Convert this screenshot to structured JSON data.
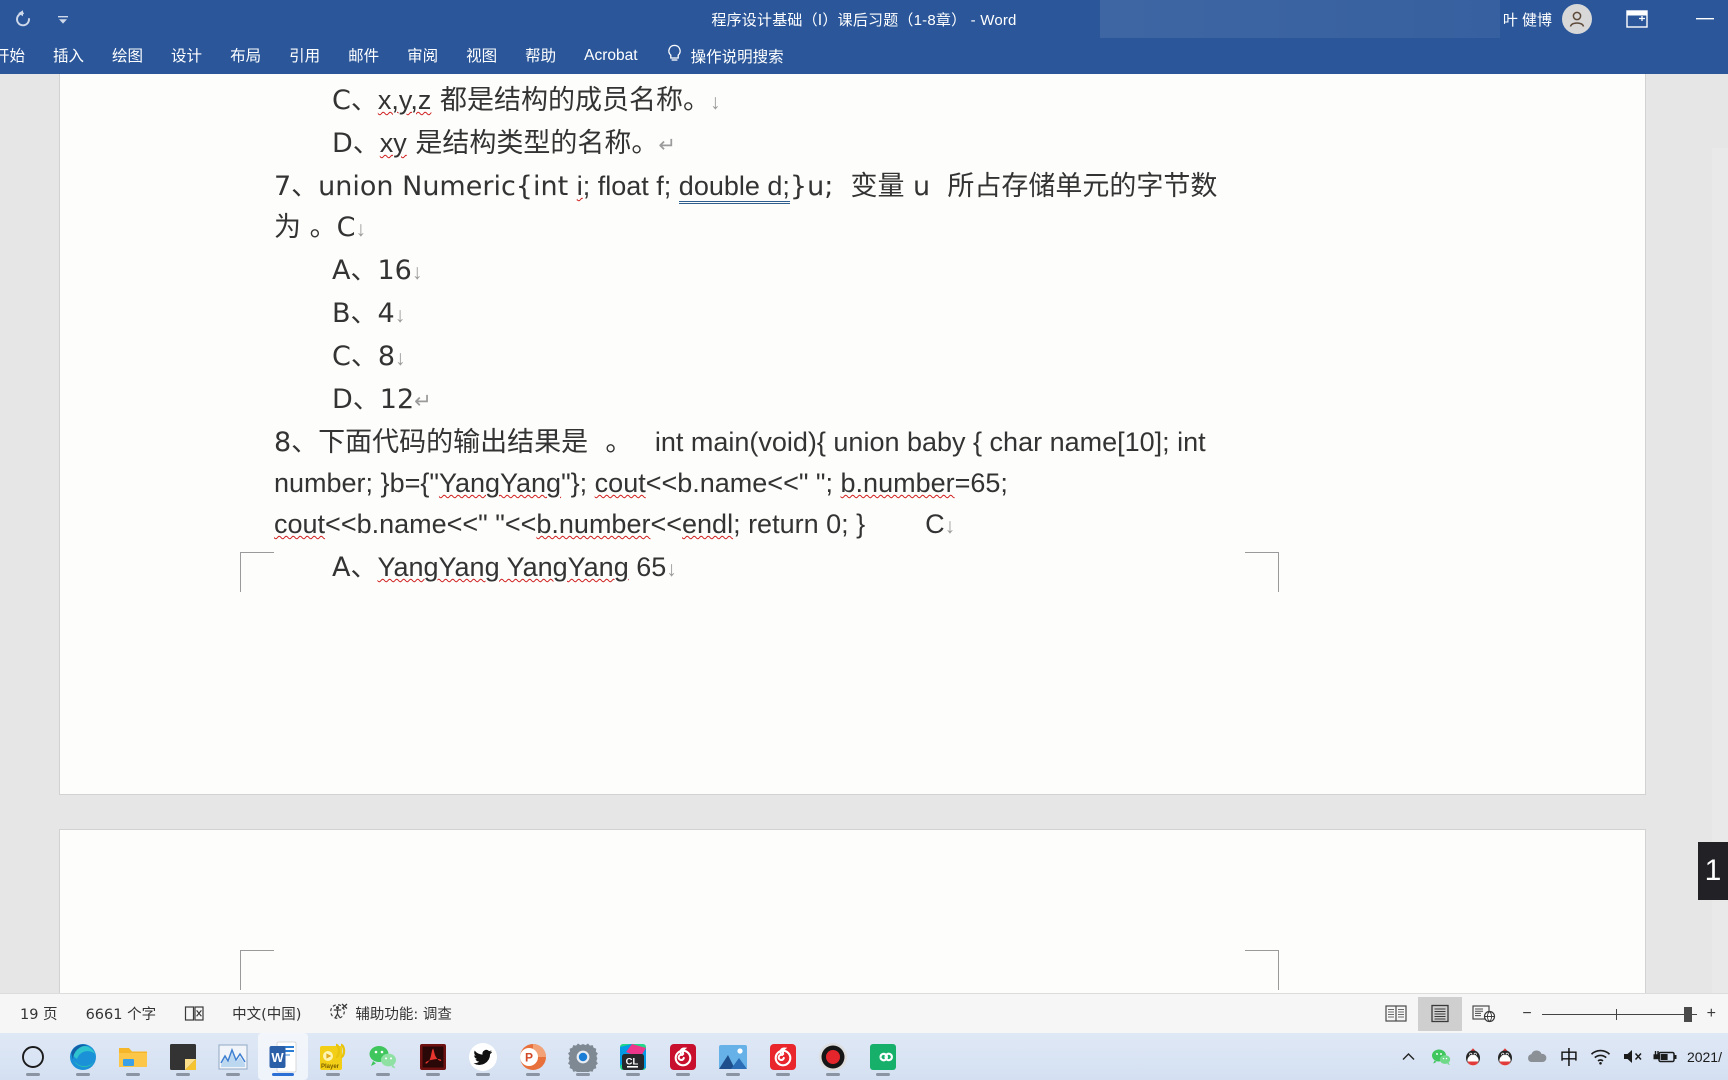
{
  "titlebar": {
    "quick_access": [
      {
        "name": "redo-icon",
        "label": "撤销/恢复"
      },
      {
        "name": "customize-quick-access-chevron-icon",
        "label": "自定义快速访问工具栏"
      }
    ],
    "document_title": "程序设计基础（Ⅰ）课后习题（1-8章）  -  Word",
    "user_name": "叶 健博",
    "avatar_name": "user-avatar",
    "ribbon_display_options_label": "功能区显示选项",
    "minimize_label": "最小化",
    "accent_color": "#2b579a"
  },
  "ribbon": {
    "tabs": [
      {
        "label": "开始"
      },
      {
        "label": "插入"
      },
      {
        "label": "绘图"
      },
      {
        "label": "设计"
      },
      {
        "label": "布局"
      },
      {
        "label": "引用"
      },
      {
        "label": "邮件"
      },
      {
        "label": "审阅"
      },
      {
        "label": "视图"
      },
      {
        "label": "帮助"
      },
      {
        "label": "Acrobat"
      }
    ],
    "tell_me": "操作说明搜索",
    "tell_me_icon": "lightbulb-icon"
  },
  "document": {
    "lines": [
      {
        "id": "opt-c-struct-members",
        "indent": "indent1",
        "segments": [
          {
            "text": "C、",
            "style": "cjk"
          },
          {
            "text": "x,y,z",
            "style": "spell"
          },
          {
            "text": " 都是结构的成员名称。",
            "style": "cjk"
          },
          {
            "text": "↓",
            "style": "mark"
          }
        ]
      },
      {
        "id": "opt-d-struct-type-name",
        "indent": "indent1",
        "segments": [
          {
            "text": "D、",
            "style": "cjk"
          },
          {
            "text": "xy",
            "style": "spell"
          },
          {
            "text": " 是结构类型的名称。",
            "style": "cjk"
          },
          {
            "text": "↵",
            "style": "mark"
          }
        ]
      },
      {
        "id": "question-7-line1",
        "indent": "indent0",
        "segments": [
          {
            "text": "7、union Numeric{int ",
            "style": "cjk"
          },
          {
            "text": "i",
            "style": "spell"
          },
          {
            "text": "; float f; ",
            "style": ""
          },
          {
            "text": "double d;",
            "style": "blueul"
          },
          {
            "text": "}u;  变量 u  所占存储单元的字节数",
            "style": "cjk"
          }
        ]
      },
      {
        "id": "question-7-line2",
        "indent": "indent0",
        "segments": [
          {
            "text": "为 。C",
            "style": "cjk"
          },
          {
            "text": "↓",
            "style": "mark"
          }
        ]
      },
      {
        "id": "q7-option-a",
        "indent": "indent1",
        "segments": [
          {
            "text": "A、16",
            "style": "cjk"
          },
          {
            "text": "↓",
            "style": "mark"
          }
        ]
      },
      {
        "id": "q7-option-b",
        "indent": "indent1",
        "segments": [
          {
            "text": "B、4",
            "style": "cjk"
          },
          {
            "text": "↓",
            "style": "mark"
          }
        ]
      },
      {
        "id": "q7-option-c",
        "indent": "indent1",
        "segments": [
          {
            "text": "C、8",
            "style": "cjk"
          },
          {
            "text": "↓",
            "style": "mark"
          }
        ]
      },
      {
        "id": "q7-option-d",
        "indent": "indent1",
        "segments": [
          {
            "text": "D、12",
            "style": "cjk"
          },
          {
            "text": "↵",
            "style": "mark"
          }
        ]
      },
      {
        "id": "question-8-line1",
        "indent": "indent0",
        "segments": [
          {
            "text": "8、下面代码的输出结果是  。",
            "style": "cjk"
          },
          {
            "text": "   int main(void){ union baby { char name[10]; int",
            "style": ""
          }
        ]
      },
      {
        "id": "question-8-line2",
        "indent": "indent0",
        "segments": [
          {
            "text": "number; }b={\"",
            "style": ""
          },
          {
            "text": "YangYang",
            "style": "spell"
          },
          {
            "text": "\"}; ",
            "style": ""
          },
          {
            "text": "cout",
            "style": "spell"
          },
          {
            "text": "<<b.name<<\" \"; ",
            "style": ""
          },
          {
            "text": "b.number",
            "style": "spell"
          },
          {
            "text": "=65;",
            "style": ""
          }
        ]
      },
      {
        "id": "question-8-line3",
        "indent": "indent0",
        "segments": [
          {
            "text": "cout",
            "style": "spell"
          },
          {
            "text": "<<b.name<<\" \"<<",
            "style": ""
          },
          {
            "text": "b.number",
            "style": "spell"
          },
          {
            "text": "<<",
            "style": ""
          },
          {
            "text": "endl",
            "style": "spell"
          },
          {
            "text": "; return 0; }        C",
            "style": ""
          },
          {
            "text": "↓",
            "style": "mark"
          }
        ]
      },
      {
        "id": "q8-option-a",
        "indent": "indent1",
        "segments": [
          {
            "text": "A、",
            "style": "cjk"
          },
          {
            "text": "YangYang YangYang",
            "style": "spell"
          },
          {
            "text": " 65",
            "style": ""
          },
          {
            "text": "↓",
            "style": "mark"
          }
        ]
      }
    ]
  },
  "statusbar": {
    "page_count": "19 页",
    "word_count": "6661 个字",
    "proofing_icon": "proofing-errors-icon",
    "language": "中文(中国)",
    "accessibility_icon": "accessibility-icon",
    "accessibility": "辅助功能: 调查",
    "views": [
      {
        "name": "read-mode-view-button",
        "label": "阅读视图",
        "active": false
      },
      {
        "name": "print-layout-view-button",
        "label": "页面视图",
        "active": true
      },
      {
        "name": "web-layout-view-button",
        "label": "Web 版式视图",
        "active": false
      }
    ],
    "zoom_out_label": "−",
    "zoom_in_label": "+"
  },
  "taskbar": {
    "apps": [
      {
        "name": "cortana-search-icon",
        "label": "搜索",
        "active": false
      },
      {
        "name": "microsoft-edge-icon",
        "label": "Microsoft Edge",
        "active": false
      },
      {
        "name": "file-explorer-icon",
        "label": "文件资源管理器",
        "active": false
      },
      {
        "name": "sticky-notes-icon",
        "label": "便笺",
        "active": false
      },
      {
        "name": "chart-app-icon",
        "label": "图表应用",
        "active": false
      },
      {
        "name": "microsoft-word-icon",
        "label": "Word",
        "active": true
      },
      {
        "name": "media-player-icon",
        "label": "播放器",
        "active": false
      },
      {
        "name": "wechat-icon",
        "label": "微信",
        "active": false
      },
      {
        "name": "adobe-acrobat-icon",
        "label": "Adobe Acrobat",
        "active": false
      },
      {
        "name": "twitter-icon",
        "label": "Twitter",
        "active": false
      },
      {
        "name": "powerpoint-icon",
        "label": "PowerPoint",
        "active": false
      },
      {
        "name": "settings-gear-icon",
        "label": "设置",
        "active": false
      },
      {
        "name": "clion-icon",
        "label": "CLion",
        "active": false
      },
      {
        "name": "netease-music-icon",
        "label": "网易云音乐",
        "active": false
      },
      {
        "name": "photos-icon",
        "label": "照片",
        "active": false
      },
      {
        "name": "netease-music-red-icon",
        "label": "网易云音乐",
        "active": false
      },
      {
        "name": "screen-recorder-icon",
        "label": "录屏",
        "active": false
      },
      {
        "name": "camtasia-icon",
        "label": "Camtasia",
        "active": false
      }
    ],
    "tray": [
      {
        "name": "show-hidden-icons-chevron-icon",
        "label": "显示隐藏的图标"
      },
      {
        "name": "wechat-tray-icon",
        "label": "微信"
      },
      {
        "name": "qq-tray-icon",
        "label": "QQ"
      },
      {
        "name": "qq-tray-icon-2",
        "label": "QQ"
      },
      {
        "name": "cloud-tray-icon",
        "label": "云"
      },
      {
        "name": "ime-chinese-icon",
        "label": "中"
      },
      {
        "name": "network-wifi-icon",
        "label": "网络"
      },
      {
        "name": "volume-muted-icon",
        "label": "音量已静音"
      },
      {
        "name": "battery-charging-icon",
        "label": "电源"
      }
    ],
    "clock": "2021/"
  },
  "overlay": {
    "badge_text": "1"
  }
}
